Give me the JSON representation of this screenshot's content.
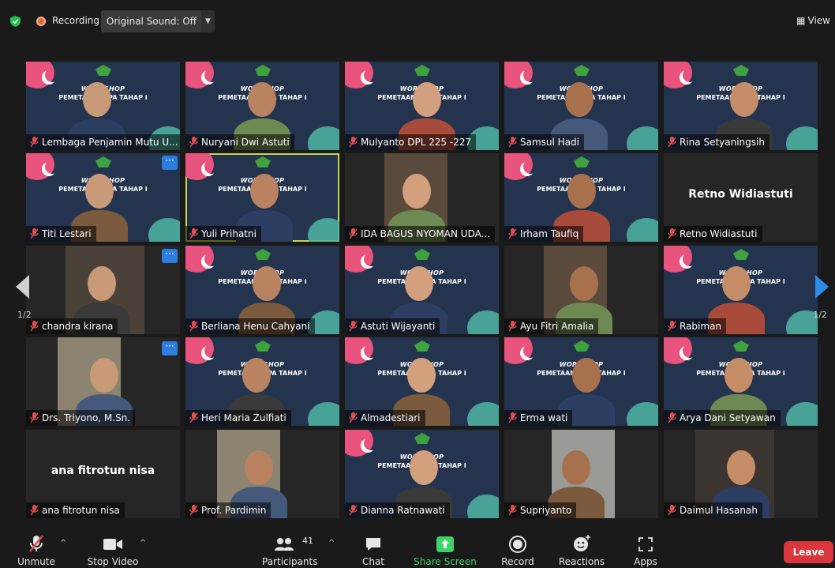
{
  "top_bar": {
    "recording_label": "Recording",
    "original_sound_label": "Original Sound: Off",
    "view_label": "View"
  },
  "pagination": {
    "left_page": "1/2",
    "right_page": "1/2"
  },
  "participants": [
    {
      "name": "Lembaga Penjamin Mutu U...",
      "slide": true
    },
    {
      "name": "Nuryani Dwi Astuti",
      "slide": true
    },
    {
      "name": "Mulyanto DPL 225 -227",
      "slide": true
    },
    {
      "name": "Samsul Hadi",
      "slide": true
    },
    {
      "name": "Rina Setyaningsih",
      "slide": true
    },
    {
      "name": "Titi Lestari",
      "slide": true
    },
    {
      "name": "Yuli Prihatni",
      "slide": true
    },
    {
      "name": "IDA BAGUS NYOMAN UDA...",
      "slide": false
    },
    {
      "name": "Irham Taufiq",
      "slide": true
    },
    {
      "name": "Retno Widiastuti",
      "slide": false,
      "center_name": "Retno Widiastuti"
    },
    {
      "name": "chandra kirana",
      "slide": false
    },
    {
      "name": "Berliana Henu Cahyani",
      "slide": true
    },
    {
      "name": "Astuti Wijayanti",
      "slide": true
    },
    {
      "name": "Ayu Fitri Amalia",
      "slide": false
    },
    {
      "name": "Rabiman",
      "slide": true
    },
    {
      "name": "Drs. Triyono, M.Sn.",
      "slide": false
    },
    {
      "name": "Heri  Maria Zulfiati",
      "slide": true
    },
    {
      "name": "Almadestiari",
      "slide": true
    },
    {
      "name": "Erma wati",
      "slide": true
    },
    {
      "name": "Arya Dani Setyawan",
      "slide": true
    },
    {
      "name": "ana fitrotun nisa",
      "slide": false,
      "center_name": "ana fitrotun nisa"
    },
    {
      "name": "Prof. Pardimin",
      "slide": false
    },
    {
      "name": "Dianna Ratnawati",
      "slide": true
    },
    {
      "name": "Supriyanto",
      "slide": false
    },
    {
      "name": "Daimul Hasanah",
      "slide": false
    }
  ],
  "slide_text": {
    "line1": "WORKSHOP",
    "line2": "PEMETAAN PEPA TAHAP I"
  },
  "more_button": "···",
  "toolbar": {
    "unmute": "Unmute",
    "stop_video": "Stop Video",
    "participants": "Participants",
    "participants_count": "41",
    "chat": "Chat",
    "share_screen": "Share Screen",
    "record": "Record",
    "reactions": "Reactions",
    "apps": "Apps",
    "leave": "Leave"
  },
  "colors": {
    "share_green": "#3fd46a",
    "leave_red": "#d9363e",
    "active_speaker": "#c8d64d",
    "accent_blue": "#2e7de1"
  }
}
